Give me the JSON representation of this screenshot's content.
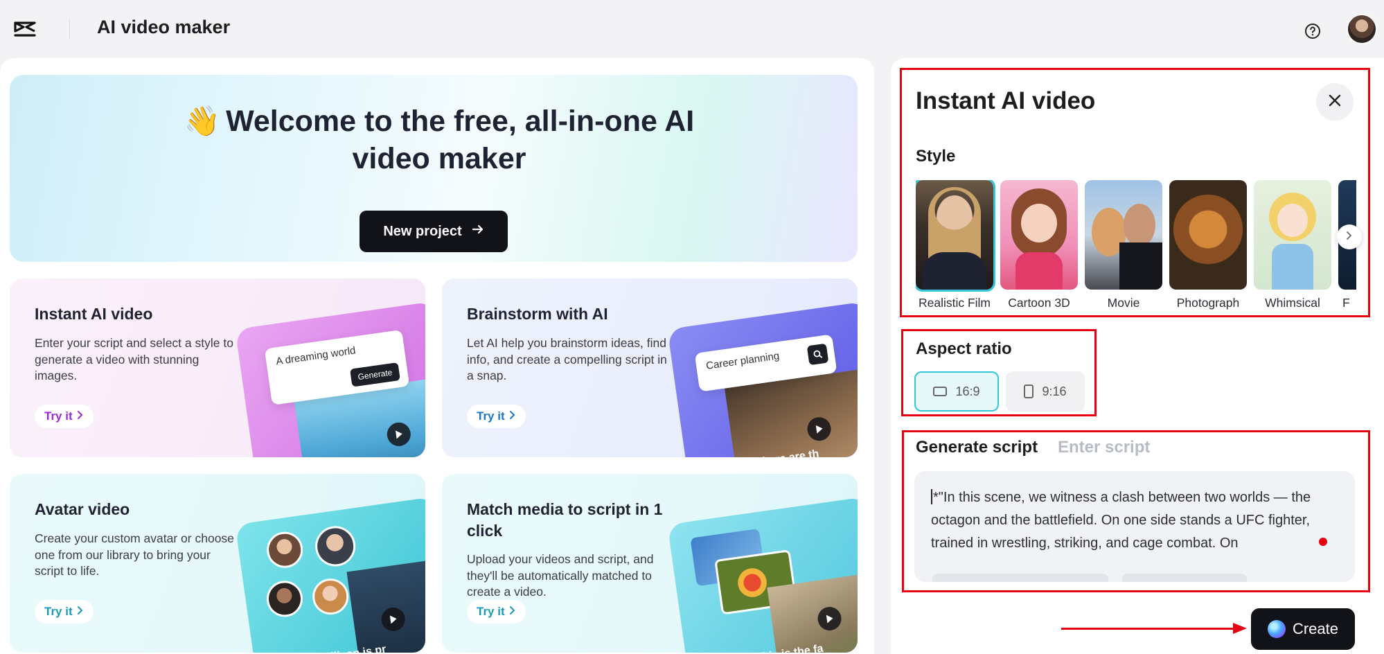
{
  "header": {
    "app_title": "AI video maker",
    "logo_icon": "capcut-logo-icon",
    "help_icon": "help-icon"
  },
  "hero": {
    "emoji": "👋",
    "title": "Welcome to the free, all-in-one AI video maker",
    "new_project_label": "New project"
  },
  "cards": [
    {
      "title": "Instant AI video",
      "description": "Enter your script and select a style to generate a video with stunning images.",
      "cta": "Try it",
      "art_prompt": "A dreaming world",
      "art_button": "Generate",
      "accent": "#9b2bd6"
    },
    {
      "title": "Brainstorm with AI",
      "description": "Let AI help you brainstorm ideas, find info, and create a compelling script in a snap.",
      "cta": "Try it",
      "art_prompt": "Career planning",
      "art_caption": "There are th",
      "accent": "#1877c9"
    },
    {
      "title": "Avatar video",
      "description": "Create your custom avatar or choose one from our library to bring your script to life.",
      "cta": "Try it",
      "art_caption": "Silicon is pr",
      "accent": "#1a9bb5"
    },
    {
      "title": "Match media to script in 1 click",
      "description": "Upload your videos and script, and they'll be automatically matched to create a video.",
      "cta": "Try it",
      "art_caption": "This is the fa",
      "accent": "#1a9bb5"
    }
  ],
  "instant_panel": {
    "title": "Instant AI video",
    "style_label": "Style",
    "styles": [
      {
        "label": "Realistic Film",
        "selected": true
      },
      {
        "label": "Cartoon 3D",
        "selected": false
      },
      {
        "label": "Movie",
        "selected": false
      },
      {
        "label": "Photograph",
        "selected": false
      },
      {
        "label": "Whimsical",
        "selected": false
      },
      {
        "label": "F",
        "selected": false
      }
    ],
    "aspect_label": "Aspect ratio",
    "aspect_options": [
      {
        "label": "16:9",
        "active": true
      },
      {
        "label": "9:16",
        "active": false
      }
    ],
    "tab_generate": "Generate script",
    "tab_enter": "Enter script",
    "script_text": "*\"In this scene, we witness a clash between two worlds — the octagon and the battlefield. On one side stands a UFC fighter, trained in wrestling, striking, and cage combat. On",
    "create_label": "Create"
  },
  "colors": {
    "annotation_red": "#e60012",
    "selection_cyan": "#33c5d8",
    "button_dark": "#111318"
  }
}
